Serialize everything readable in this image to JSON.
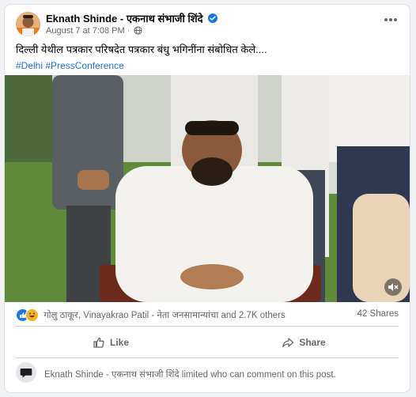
{
  "post": {
    "author": "Eknath Shinde - एकनाथ संभाजी शिंदे",
    "date": "August 7 at 7:08 PM",
    "separator": "·",
    "text": "दिल्ली येथील पत्रकार परिषदेत पत्रकार बंधु भगिनींना संबोधित केले....",
    "hashtags": [
      "#Delhi",
      "#PressConference"
    ]
  },
  "icons": {
    "verified": "verified-badge-icon",
    "audience": "globe-icon",
    "menu": "more-options-icon",
    "mute": "volume-muted-icon",
    "like": "thumbs-up-icon",
    "share": "share-arrow-icon",
    "comment_notice": "comment-bubble-icon"
  },
  "engagement": {
    "reactions_text": "गोलु ठाकूर, Vinayakrao Patil - नेता जनसामान्यांचा and 2.7K others",
    "shares": "42 Shares"
  },
  "actions": {
    "like_label": "Like",
    "share_label": "Share"
  },
  "comment_notice": {
    "text": "Eknath Shinde - एकनाथ संभाजी शिंदे limited who can comment on this post."
  },
  "colors": {
    "accent": "#1b74e4",
    "hashtag": "#216fdb",
    "muted_text": "#65676b",
    "like_reaction": "#1877f2",
    "haha_reaction": "#f7b125"
  }
}
